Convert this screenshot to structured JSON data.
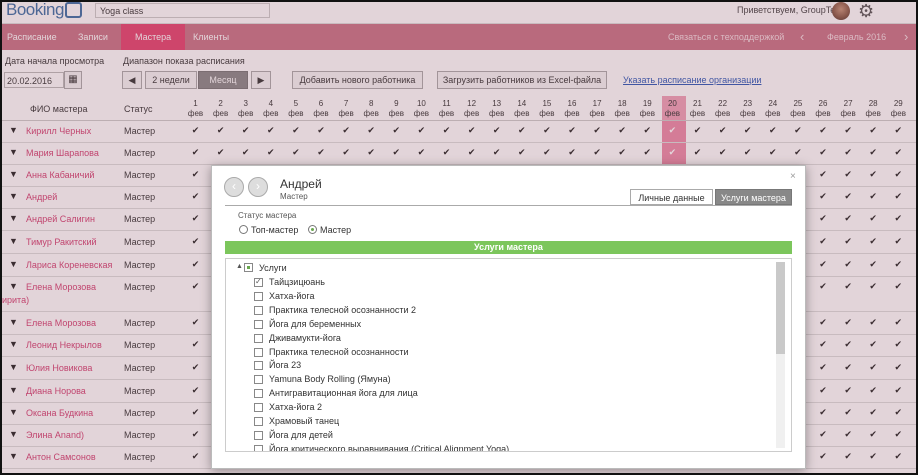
{
  "header": {
    "logo": "Booking",
    "salon_name": "Yoga class",
    "greeting": "Приветствуем, GroupTest ▾"
  },
  "nav": {
    "items": [
      "Расписание",
      "Записи",
      "Мастера",
      "Клиенты"
    ],
    "active": "Мастера",
    "support": "Связаться с техподдержкой",
    "prev": "‹",
    "month": "Февраль 2016",
    "next": "›"
  },
  "controls": {
    "date_label": "Дата начала просмотра",
    "date_value": "20.02.2016",
    "range_label": "Диапазон показа расписания",
    "prev_btn": "◀",
    "two_weeks": "2 недели",
    "month_btn": "Месяц",
    "next_btn": "▶",
    "add_worker": "Добавить нового работника",
    "upload_excel": "Загрузить работников из Excel-файла",
    "org_schedule_link": "Указать расписание организации"
  },
  "table": {
    "col_name": "ФИО мастера",
    "col_status": "Статус",
    "day_suffix": "фев",
    "days": [
      1,
      2,
      3,
      4,
      5,
      6,
      7,
      8,
      9,
      10,
      11,
      12,
      13,
      14,
      15,
      16,
      17,
      18,
      19,
      20,
      21,
      22,
      23,
      24,
      25,
      26,
      27,
      28,
      29
    ],
    "today": 20,
    "check": "✔",
    "rows": [
      {
        "name": "Кирилл Черных",
        "status": "Мастер"
      },
      {
        "name": "Мария Шарапова",
        "status": "Мастер"
      },
      {
        "name": "Анна Кабаничий",
        "status": "Мастер"
      },
      {
        "name": "Андрей",
        "status": "Мастер"
      },
      {
        "name": "Андрей Салигин",
        "status": "Мастер"
      },
      {
        "name": "Тимур Ракитский",
        "status": "Мастер"
      },
      {
        "name": "Лариса Кореневская",
        "status": "Мастер"
      },
      {
        "name": "Елена Морозова",
        "name2": "ирита)",
        "status": "Мастер"
      },
      {
        "name": "Елена Морозова",
        "status": "Мастер"
      },
      {
        "name": "Леонид Некрылов",
        "status": "Мастер"
      },
      {
        "name": "Юлия Новикова",
        "status": "Мастер"
      },
      {
        "name": "Диана Норова",
        "status": "Мастер"
      },
      {
        "name": "Оксана Будкина",
        "status": "Мастер"
      },
      {
        "name": "Элина Anand)",
        "status": "Мастер"
      },
      {
        "name": "Антон Самсонов",
        "status": "Мастер"
      }
    ]
  },
  "modal": {
    "prev": "‹",
    "next": "›",
    "title": "Андрей",
    "subtitle": "Мастер",
    "close": "×",
    "tab_personal": "Личные данные",
    "tab_services": "Услуги мастера",
    "status_label": "Статус мастера",
    "radio_top": "Топ-мастер",
    "radio_master": "Мастер",
    "selected_status": "Мастер",
    "section": "Услуги мастера",
    "tree_toggle": "▲",
    "root": "Услуги",
    "services": [
      {
        "name": "Тайцзицюань",
        "checked": true
      },
      {
        "name": "Хатха-йога",
        "checked": false
      },
      {
        "name": "Практика телесной осознанности 2",
        "checked": false
      },
      {
        "name": "Йога для беременных",
        "checked": false
      },
      {
        "name": "Дживамукти-йога",
        "checked": false
      },
      {
        "name": "Практика телесной осознанности",
        "checked": false
      },
      {
        "name": "Йога 23",
        "checked": false
      },
      {
        "name": "Yamuna Body Rolling (Ямуна)",
        "checked": false
      },
      {
        "name": "Антигравитационная йога для лица",
        "checked": false
      },
      {
        "name": "Хатха-йога 2",
        "checked": false
      },
      {
        "name": "Храмовый танец",
        "checked": false
      },
      {
        "name": "Йога для детей",
        "checked": false
      },
      {
        "name": "Йога критического выравнивания (Critical Alignment Yoga)",
        "checked": false
      }
    ]
  }
}
